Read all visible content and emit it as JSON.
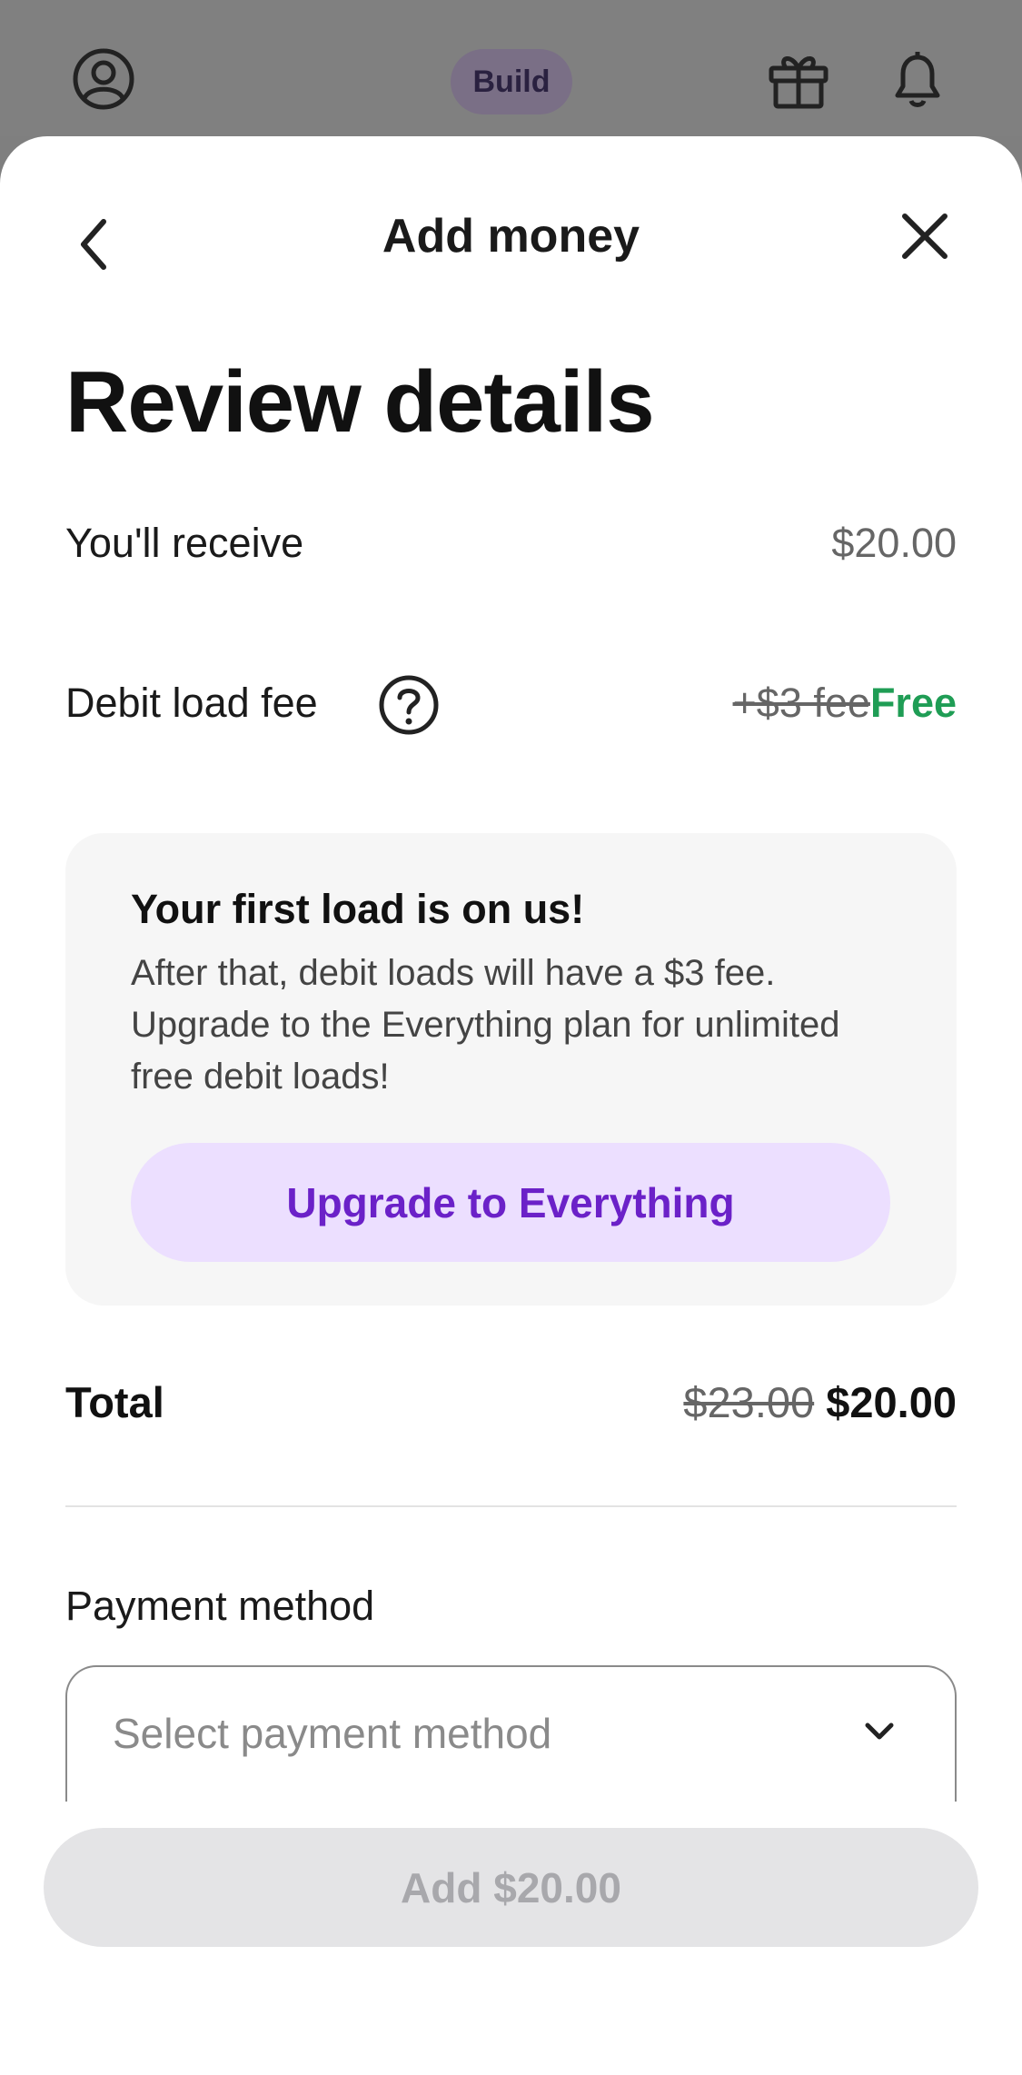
{
  "topbar": {
    "build_label": "Build"
  },
  "sheet": {
    "title": "Add money"
  },
  "page_title": "Review details",
  "receive": {
    "label": "You'll receive",
    "value": "$20.00"
  },
  "fee": {
    "label": "Debit load fee",
    "old_fee": "+$3 fee",
    "new_fee": "Free"
  },
  "promo": {
    "title": "Your first load is on us!",
    "body": "After that, debit loads will have a $3 fee. Upgrade to the Everything plan for unlimited free debit loads!",
    "button_label": "Upgrade to Everything"
  },
  "total": {
    "label": "Total",
    "old_value": "$23.00",
    "new_value": "$20.00"
  },
  "payment": {
    "label": "Payment method",
    "placeholder": "Select payment method"
  },
  "add_button_label": "Add $20.00",
  "colors": {
    "accent": "#6b21c8",
    "accent_bg": "#ecdfff",
    "free_green": "#1f9d55",
    "disabled_bg": "#e4e4e6"
  }
}
